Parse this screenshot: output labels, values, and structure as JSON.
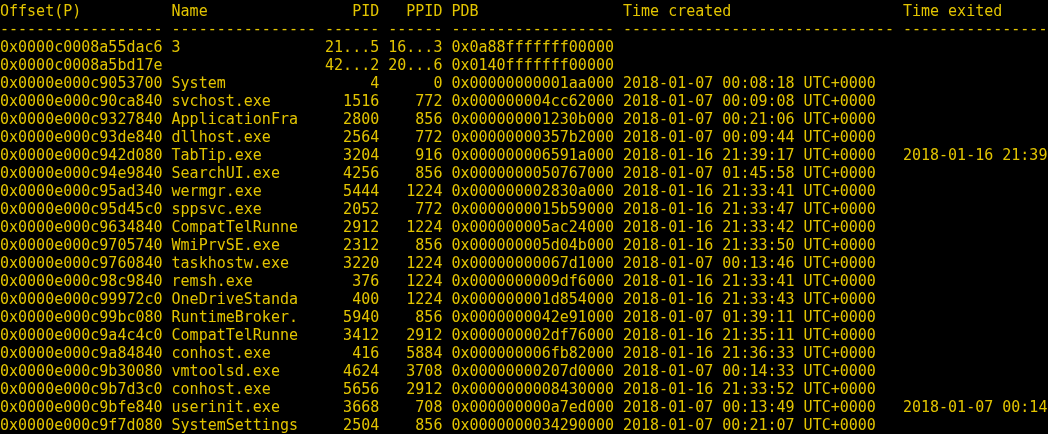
{
  "table": {
    "columns": [
      {
        "label": "Offset(P)",
        "rule": "------------------"
      },
      {
        "label": "Name",
        "rule": "----------------"
      },
      {
        "label": "PID",
        "rule": "------"
      },
      {
        "label": "PPID",
        "rule": "------"
      },
      {
        "label": "PDB",
        "rule": "------------------"
      },
      {
        "label": "Time created",
        "rule": "------------------------------"
      },
      {
        "label": "Time exited",
        "rule": "----------------"
      }
    ],
    "rows": [
      {
        "offset": "0x0000c0008a55dac6",
        "name": "3",
        "pid": "21...5",
        "ppid": "16...3",
        "pdb": "0x0a88fffffff00000"
      },
      {
        "offset": "0x0000c0008a5bd17e",
        "pid": "42...2",
        "ppid": "20...6",
        "pdb": "0x0140fffffff00000"
      },
      {
        "offset": "0x0000e000c9053700",
        "name": "System",
        "pid": "4",
        "ppid": "0",
        "pdb": "0x00000000001aa000",
        "time_created": "2018-01-07 00:08:18 UTC+0000"
      },
      {
        "offset": "0x0000e000c90ca840",
        "name": "svchost.exe",
        "pid": "1516",
        "ppid": "772",
        "pdb": "0x000000004cc62000",
        "time_created": "2018-01-07 00:09:08 UTC+0000"
      },
      {
        "offset": "0x0000e000c9327840",
        "name": "ApplicationFra",
        "pid": "2800",
        "ppid": "856",
        "pdb": "0x000000001230b000",
        "time_created": "2018-01-07 00:21:06 UTC+0000"
      },
      {
        "offset": "0x0000e000c93de840",
        "name": "dllhost.exe",
        "pid": "2564",
        "ppid": "772",
        "pdb": "0x00000000357b2000",
        "time_created": "2018-01-07 00:09:44 UTC+0000"
      },
      {
        "offset": "0x0000e000c942d080",
        "name": "TabTip.exe",
        "pid": "3204",
        "ppid": "916",
        "pdb": "0x000000006591a000",
        "time_created": "2018-01-16 21:39:17 UTC+0000",
        "time_exited": "2018-01-16 21:39"
      },
      {
        "offset": "0x0000e000c94e9840",
        "name": "SearchUI.exe",
        "pid": "4256",
        "ppid": "856",
        "pdb": "0x0000000050767000",
        "time_created": "2018-01-07 01:45:58 UTC+0000"
      },
      {
        "offset": "0x0000e000c95ad340",
        "name": "wermgr.exe",
        "pid": "5444",
        "ppid": "1224",
        "pdb": "0x000000002830a000",
        "time_created": "2018-01-16 21:33:41 UTC+0000"
      },
      {
        "offset": "0x0000e000c95d45c0",
        "name": "sppsvc.exe",
        "pid": "2052",
        "ppid": "772",
        "pdb": "0x0000000015b59000",
        "time_created": "2018-01-16 21:33:47 UTC+0000"
      },
      {
        "offset": "0x0000e000c9634840",
        "name": "CompatTelRunne",
        "pid": "2912",
        "ppid": "1224",
        "pdb": "0x000000005ac24000",
        "time_created": "2018-01-16 21:33:42 UTC+0000"
      },
      {
        "offset": "0x0000e000c9705740",
        "name": "WmiPrvSE.exe",
        "pid": "2312",
        "ppid": "856",
        "pdb": "0x000000005d04b000",
        "time_created": "2018-01-16 21:33:50 UTC+0000"
      },
      {
        "offset": "0x0000e000c9760840",
        "name": "taskhostw.exe",
        "pid": "3220",
        "ppid": "1224",
        "pdb": "0x00000000067d1000",
        "time_created": "2018-01-07 00:13:46 UTC+0000"
      },
      {
        "offset": "0x0000e000c98c9840",
        "name": "remsh.exe",
        "pid": "376",
        "ppid": "1224",
        "pdb": "0x0000000009df6000",
        "time_created": "2018-01-16 21:33:41 UTC+0000"
      },
      {
        "offset": "0x0000e000c99972c0",
        "name": "OneDriveStanda",
        "pid": "400",
        "ppid": "1224",
        "pdb": "0x000000001d854000",
        "time_created": "2018-01-16 21:33:43 UTC+0000"
      },
      {
        "offset": "0x0000e000c99bc080",
        "name": "RuntimeBroker.",
        "pid": "5940",
        "ppid": "856",
        "pdb": "0x0000000042e91000",
        "time_created": "2018-01-07 01:39:11 UTC+0000"
      },
      {
        "offset": "0x0000e000c9a4c4c0",
        "name": "CompatTelRunne",
        "pid": "3412",
        "ppid": "2912",
        "pdb": "0x000000002df76000",
        "time_created": "2018-01-16 21:35:11 UTC+0000"
      },
      {
        "offset": "0x0000e000c9a84840",
        "name": "conhost.exe",
        "pid": "416",
        "ppid": "5884",
        "pdb": "0x000000006fb82000",
        "time_created": "2018-01-16 21:36:33 UTC+0000"
      },
      {
        "offset": "0x0000e000c9b30080",
        "name": "vmtoolsd.exe",
        "pid": "4624",
        "ppid": "3708",
        "pdb": "0x00000000207d0000",
        "time_created": "2018-01-07 00:14:33 UTC+0000"
      },
      {
        "offset": "0x0000e000c9b7d3c0",
        "name": "conhost.exe",
        "pid": "5656",
        "ppid": "2912",
        "pdb": "0x0000000008430000",
        "time_created": "2018-01-16 21:33:52 UTC+0000"
      },
      {
        "offset": "0x0000e000c9bfe840",
        "name": "userinit.exe",
        "pid": "3668",
        "ppid": "708",
        "pdb": "0x000000000a7ed000",
        "time_created": "2018-01-07 00:13:49 UTC+0000",
        "time_exited": "2018-01-07 00:14"
      },
      {
        "offset": "0x0000e000c9f7d080",
        "name": "SystemSettings",
        "pid": "2504",
        "ppid": "856",
        "pdb": "0x0000000034290000",
        "time_created": "2018-01-07 00:21:07 UTC+0000"
      }
    ]
  }
}
